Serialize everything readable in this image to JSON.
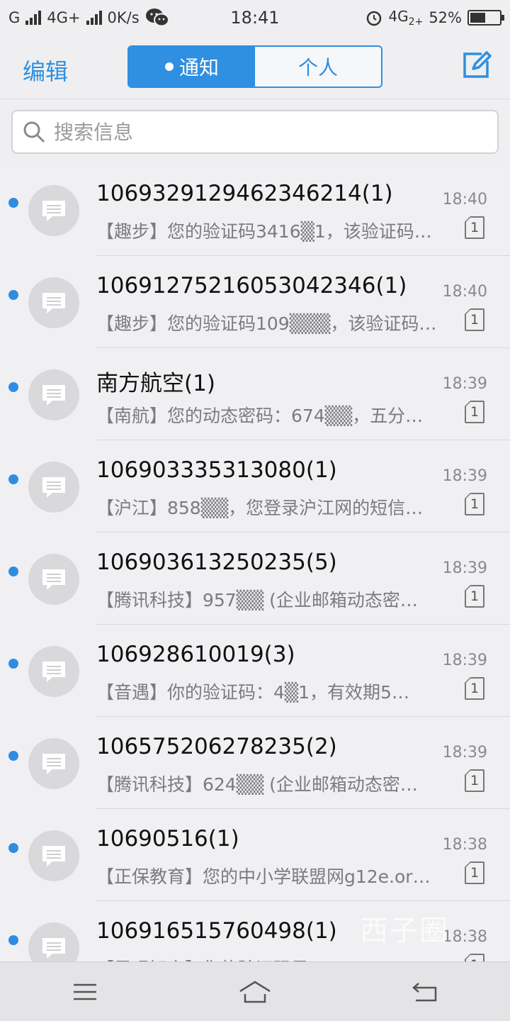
{
  "status_bar": {
    "carrier_left": "G",
    "network_left": "4G+",
    "speed": "0K/s",
    "time": "18:41",
    "network_right": "4G",
    "network_right_sub": "2+",
    "battery": "52%",
    "battery_level": 0.52
  },
  "header": {
    "edit_label": "编辑",
    "tabs": [
      {
        "label": "通知",
        "active": true
      },
      {
        "label": "个人",
        "active": false
      }
    ],
    "compose_icon": "compose-icon"
  },
  "search": {
    "placeholder": "搜索信息"
  },
  "messages": [
    {
      "sender": "106932912946234621​4(1)",
      "time": "18:40",
      "preview": "【趣步】您的验证码3416▒1，该验证码…",
      "sim": "1"
    },
    {
      "sender": "106912752160530423​46(1)",
      "time": "18:40",
      "preview": "【趣步】您的验证码109▒▒▒，该验证码…",
      "sim": "1"
    },
    {
      "sender": "南方航空(1)",
      "time": "18:39",
      "preview": "【南航】您的动态密码：674▒▒，五分…",
      "sim": "1"
    },
    {
      "sender": "106903335313080(1)",
      "time": "18:39",
      "preview": "【沪江】858▒▒，您登录沪江网的短信…",
      "sim": "1"
    },
    {
      "sender": "106903613250235(5)",
      "time": "18:39",
      "preview": "【腾讯科技】957▒▒ (企业邮箱动态密…",
      "sim": "1"
    },
    {
      "sender": "106928610019(3)",
      "time": "18:39",
      "preview": "【音遇】你的验证码：4▒1，有效期5…",
      "sim": "1"
    },
    {
      "sender": "106575206278235(2)",
      "time": "18:39",
      "preview": "【腾讯科技】624▒▒ (企业邮箱动态密…",
      "sim": "1"
    },
    {
      "sender": "10690516(1)",
      "time": "18:38",
      "preview": "【正保教育】您的中小学联盟网g12e.or…",
      "sim": "1"
    },
    {
      "sender": "106916515760498(1)",
      "time": "18:38",
      "preview": "【早唱智言】您的验证码是…",
      "sim": "1"
    }
  ],
  "watermark": "西子圈",
  "nav": {
    "menu_icon": "menu-icon",
    "home_icon": "home-icon",
    "back_icon": "back-icon"
  },
  "colors": {
    "accent": "#2f8fe0",
    "unread_dot": "#2e8de2",
    "background": "#efeff1"
  }
}
